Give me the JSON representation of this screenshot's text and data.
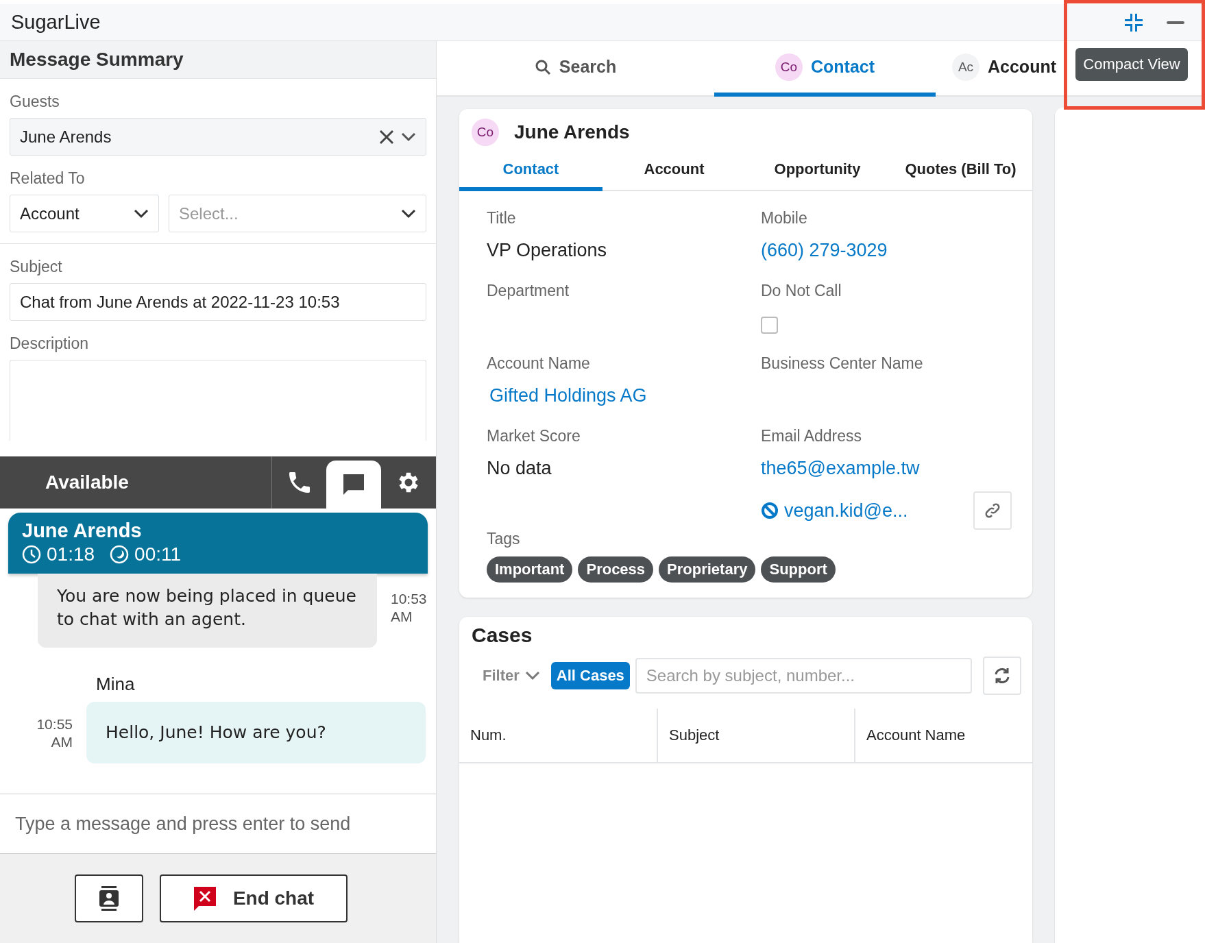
{
  "app_title": "SugarLive",
  "window_controls": {
    "tooltip": "Compact View",
    "highlighted": true
  },
  "message_summary": {
    "title": "Message Summary",
    "guests": {
      "label": "Guests",
      "value": "June Arends"
    },
    "related_to": {
      "label": "Related To",
      "module": "Account",
      "record_placeholder": "Select..."
    },
    "subject": {
      "label": "Subject",
      "value": "Chat from June Arends at 2022-11-23 10:53"
    },
    "description": {
      "label": "Description"
    }
  },
  "chat": {
    "status": "Available",
    "toolbar": [
      {
        "kind": "phone",
        "selected": false
      },
      {
        "kind": "chat",
        "selected": true
      },
      {
        "kind": "settings",
        "selected": false
      }
    ],
    "contact": {
      "name": "June Arends",
      "total_time": "01:18",
      "wait_time": "00:11"
    },
    "messages": [
      {
        "kind": "incoming",
        "text": "You are now being placed in queue to chat with an agent.",
        "time": "10:53 AM"
      },
      {
        "kind": "outgoing",
        "sender": "Mina",
        "text": "Hello, June! How are you?",
        "time": "10:55 AM"
      }
    ],
    "input": {
      "placeholder": "Type a message and press enter to send"
    },
    "end_chat_label": "End chat"
  },
  "tabs": [
    {
      "kind": "search",
      "label": "Search",
      "selected": false
    },
    {
      "kind": "record",
      "badge": "Co",
      "label": "Contact",
      "selected": true
    },
    {
      "kind": "record",
      "badge": "Ac",
      "label": "Account",
      "selected": false
    }
  ],
  "record": {
    "badge": "Co",
    "name": "June Arends",
    "tabs": [
      {
        "label": "Contact",
        "selected": true
      },
      {
        "label": "Account",
        "selected": false
      },
      {
        "label": "Opportunity",
        "selected": false
      },
      {
        "label": "Quotes (Bill To)",
        "selected": false
      }
    ],
    "fields": [
      {
        "kind": "text",
        "label": "Title",
        "value": "VP Operations"
      },
      {
        "kind": "link",
        "label": "Mobile",
        "value": "(660) 279-3029"
      },
      {
        "kind": "text",
        "label": "Department"
      },
      {
        "kind": "checkbox",
        "label": "Do Not Call",
        "checked": false
      },
      {
        "kind": "link",
        "label": "Account Name",
        "value": "Gifted Holdings AG"
      },
      {
        "kind": "text",
        "label": "Business Center Name"
      },
      {
        "kind": "text",
        "label": "Market Score",
        "value": "No data"
      },
      {
        "kind": "emails",
        "label": "Email Address",
        "emails": [
          {
            "address": "the65@example.tw",
            "opted_out": false
          },
          {
            "address": "vegan.kid@e...",
            "opted_out": true
          }
        ]
      }
    ],
    "tags_label": "Tags",
    "tags": [
      "Important",
      "Process",
      "Proprietary",
      "Support"
    ]
  },
  "cases": {
    "title": "Cases",
    "filter_label": "Filter",
    "filter_value": "All Cases",
    "search_placeholder": "Search by subject, number...",
    "columns": [
      "Num.",
      "Subject",
      "Account Name"
    ]
  }
}
